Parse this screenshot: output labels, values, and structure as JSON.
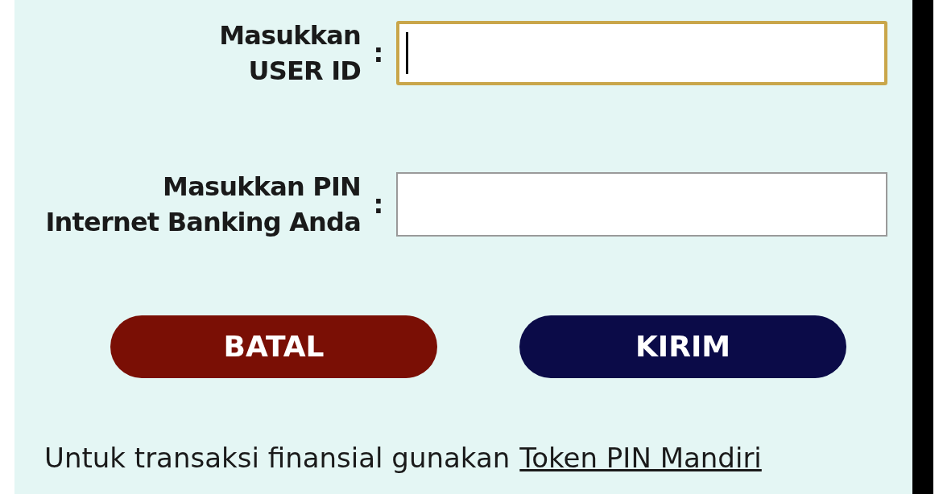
{
  "fields": [
    {
      "label_lines": [
        "Masukkan",
        "USER ID"
      ],
      "separator": ":",
      "focused": true
    },
    {
      "label_lines": [
        "Masukkan PIN",
        "Internet Banking Anda"
      ],
      "separator": ":",
      "focused": false
    }
  ],
  "buttons": [
    {
      "label": "BATAL",
      "kind": "cancel"
    },
    {
      "label": "KIRIM",
      "kind": "submit"
    }
  ],
  "footer": {
    "text": "Untuk transaksi finansial gunakan",
    "link": "Token PIN Mandiri"
  }
}
